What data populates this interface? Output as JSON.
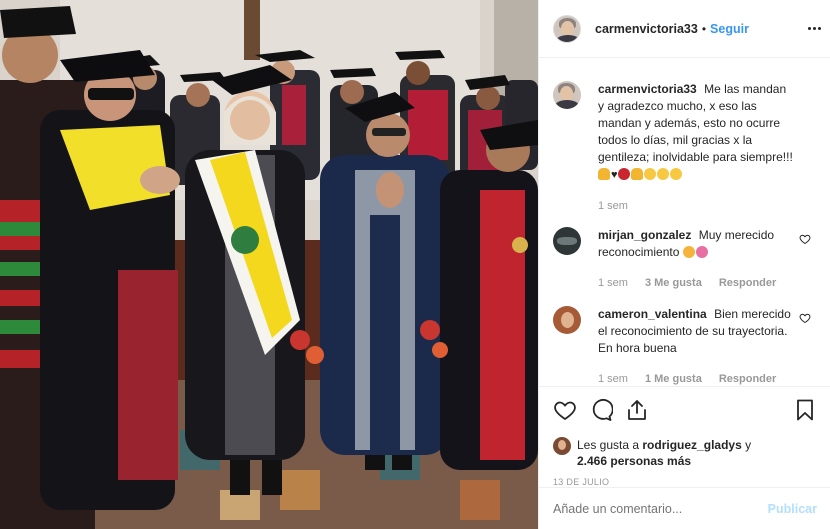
{
  "post": {
    "username": "carmenvictoria33",
    "follow_label": "Seguir",
    "dot": "•"
  },
  "comments": [
    {
      "username": "carmenvictoria33",
      "text": "Me las mandan y agradezco mucho, x eso las mandan y además, esto no ocurre todos lo días, mil gracias x la gentileza; inolvidable para siempre!!!",
      "time": "1 sem"
    },
    {
      "username": "mirjan_gonzalez",
      "text": "Muy merecido reconocimiento",
      "time": "1 sem",
      "likes": "3 Me gusta",
      "reply": "Responder"
    },
    {
      "username": "cameron_valentina",
      "text": "Bien merecido el reconocimiento de su trayectoria. En hora buena",
      "time": "1 sem",
      "likes": "1 Me gusta",
      "reply": "Responder"
    }
  ],
  "likes": {
    "prefix": "Les gusta a",
    "user": "rodriguez_gladys",
    "conj": "y",
    "count": "2.466 personas más"
  },
  "date": "13 DE JULIO",
  "add_comment": {
    "placeholder": "Añade un comentario...",
    "publish": "Publicar"
  },
  "icons": {
    "more": "more-options-icon",
    "like": "heart-icon",
    "comment": "comment-bubble-icon",
    "share": "share-icon",
    "save": "bookmark-icon"
  },
  "colors": {
    "link_blue": "#3897f0",
    "publish_disabled": "#b2dffc",
    "muted": "#999999",
    "text": "#262626",
    "border": "#efefef"
  }
}
